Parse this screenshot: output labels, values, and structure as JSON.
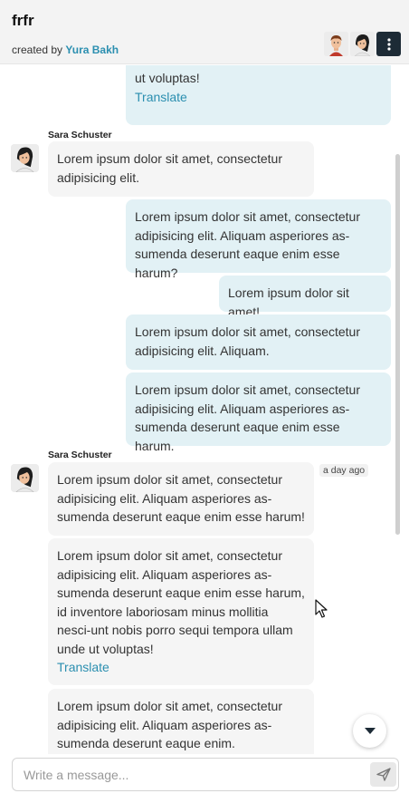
{
  "header": {
    "title": "frfr",
    "created_by_label": "created by",
    "author": "Yura Bakh",
    "menu_icon": "more-vertical-icon"
  },
  "messages": [
    {
      "type": "out",
      "text": "ut voluptas!",
      "translate": "Translate"
    },
    {
      "type": "sender",
      "name": "Sara Schuster"
    },
    {
      "type": "in",
      "text": "Lorem ipsum dolor sit amet, consectetur adipisicing elit."
    },
    {
      "type": "out",
      "text": "Lorem ipsum dolor sit amet, consectetur adipisicing elit. Aliquam asperiores as-sumenda deserunt eaque enim esse harum?"
    },
    {
      "type": "out",
      "text": "Lorem ipsum dolor sit amet!"
    },
    {
      "type": "out",
      "text": "Lorem ipsum dolor sit amet, consectetur adipisicing elit. Aliquam."
    },
    {
      "type": "out",
      "text": "Lorem ipsum dolor sit amet, consectetur adipisicing elit. Aliquam asperiores as-sumenda deserunt eaque enim esse harum."
    },
    {
      "type": "sender",
      "name": "Sara Schuster"
    },
    {
      "type": "in",
      "text": "Lorem ipsum dolor sit amet, consectetur adipisicing elit. Aliquam asperiores as-sumenda deserunt eaque enim esse harum!",
      "time": "a day ago"
    },
    {
      "type": "in",
      "text": "Lorem ipsum dolor sit amet, consectetur adipisicing elit. Aliquam asperiores as-sumenda deserunt eaque enim esse harum, id inventore laboriosam minus mollitia nesci-unt nobis porro sequi tempora ullam unde ut voluptas!",
      "translate": "Translate"
    },
    {
      "type": "in",
      "text": "Lorem ipsum dolor sit amet, consectetur adipisicing elit. Aliquam asperiores as-sumenda deserunt eaque enim."
    }
  ],
  "composer": {
    "placeholder": "Write a message...",
    "send_icon": "send-icon"
  },
  "scroll_down_icon": "chevron-down-icon",
  "colors": {
    "accent": "#2b8fb0",
    "outgoing_bubble": "#e2f1f5",
    "incoming_bubble": "#f5f5f5",
    "menu_button": "#1d2b36"
  }
}
